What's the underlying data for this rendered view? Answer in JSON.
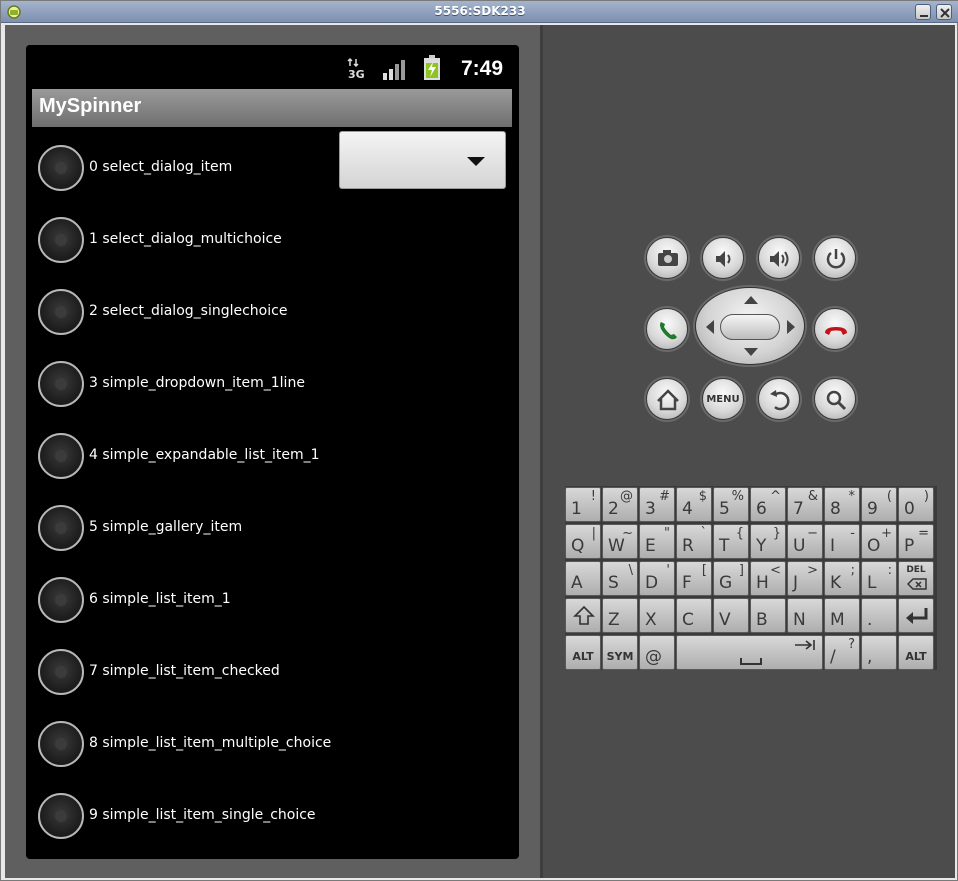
{
  "window": {
    "title": "5556:SDK233"
  },
  "device": {
    "status": {
      "time": "7:49",
      "network": "3G"
    },
    "app_title": "MySpinner",
    "spinner": {
      "selected": ""
    },
    "items": [
      "0 select_dialog_item",
      "1 select_dialog_multichoice",
      "2 select_dialog_singlechoice",
      "3 simple_dropdown_item_1line",
      "4 simple_expandable_list_item_1",
      "5 simple_gallery_item",
      "6 simple_list_item_1",
      "7 simple_list_item_checked",
      "8 simple_list_item_multiple_choice",
      "9 simple_list_item_single_choice"
    ]
  },
  "controls": {
    "menu_label": "MENU"
  },
  "keyboard": {
    "rows": [
      [
        [
          "1",
          "!"
        ],
        [
          "2",
          "@"
        ],
        [
          "3",
          "#"
        ],
        [
          "4",
          "$"
        ],
        [
          "5",
          "%"
        ],
        [
          "6",
          "^"
        ],
        [
          "7",
          "&"
        ],
        [
          "8",
          "*"
        ],
        [
          "9",
          "("
        ],
        [
          "0",
          ")"
        ]
      ],
      [
        [
          "Q",
          "|"
        ],
        [
          "W",
          "~"
        ],
        [
          "E",
          "\""
        ],
        [
          "R",
          "`"
        ],
        [
          "T",
          "{"
        ],
        [
          "Y",
          "}"
        ],
        [
          "U",
          "−"
        ],
        [
          "I",
          "-"
        ],
        [
          "O",
          "+"
        ],
        [
          "P",
          "="
        ]
      ],
      [
        [
          "A",
          ""
        ],
        [
          "S",
          "\\"
        ],
        [
          "D",
          "'"
        ],
        [
          "F",
          "["
        ],
        [
          "G",
          "]"
        ],
        [
          "H",
          "<"
        ],
        [
          "J",
          ">"
        ],
        [
          "K",
          ";"
        ],
        [
          "L",
          ":"
        ]
      ],
      [
        [
          "Z",
          ""
        ],
        [
          "X",
          ""
        ],
        [
          "C",
          ""
        ],
        [
          "V",
          ""
        ],
        [
          "B",
          ""
        ],
        [
          "N",
          ""
        ],
        [
          "M",
          ""
        ],
        [
          ".",
          ""
        ]
      ]
    ],
    "del_label": "DEL",
    "alt_label": "ALT",
    "sym_label": "SYM",
    "at_label": "@",
    "slash": [
      "/",
      "?"
    ],
    "comma": [
      ",",
      ""
    ]
  }
}
